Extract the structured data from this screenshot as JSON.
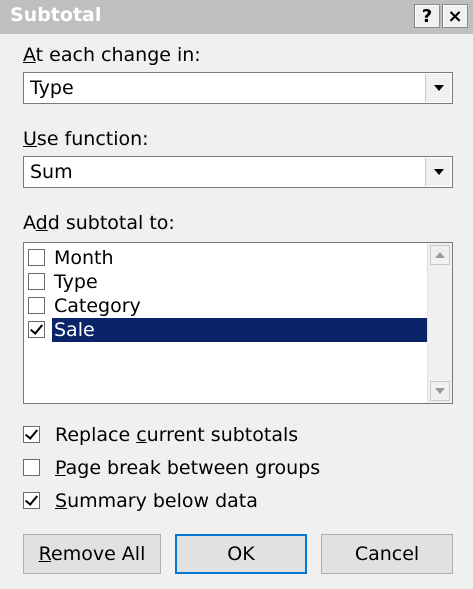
{
  "dialog": {
    "title": "Subtotal",
    "help_button": "?",
    "close_button": "×"
  },
  "at_each_change": {
    "label_access": "A",
    "label_rest": "t each change in:",
    "value": "Type"
  },
  "use_function": {
    "label_access": "U",
    "label_rest": "se function:",
    "value": "Sum"
  },
  "add_subtotal": {
    "label_pre": "A",
    "label_access": "d",
    "label_rest": "d subtotal to:",
    "items": [
      {
        "label": "Month",
        "checked": false,
        "selected": false
      },
      {
        "label": "Type",
        "checked": false,
        "selected": false
      },
      {
        "label": "Category",
        "checked": false,
        "selected": false
      },
      {
        "label": "Sale",
        "checked": true,
        "selected": true
      }
    ]
  },
  "options": {
    "replace": {
      "pre": "Replace ",
      "access": "c",
      "rest": "urrent subtotals",
      "checked": true
    },
    "page_break": {
      "pre": "",
      "access": "P",
      "rest": "age break between groups",
      "checked": false
    },
    "summary": {
      "pre": "",
      "access": "S",
      "rest": "ummary below data",
      "checked": true
    }
  },
  "buttons": {
    "remove_all_access": "R",
    "remove_all_rest": "emove All",
    "ok": "OK",
    "cancel": "Cancel"
  },
  "colors": {
    "selection": "#0a246a",
    "titlebar": "#bfbfbf",
    "background": "#f0f0f0"
  }
}
